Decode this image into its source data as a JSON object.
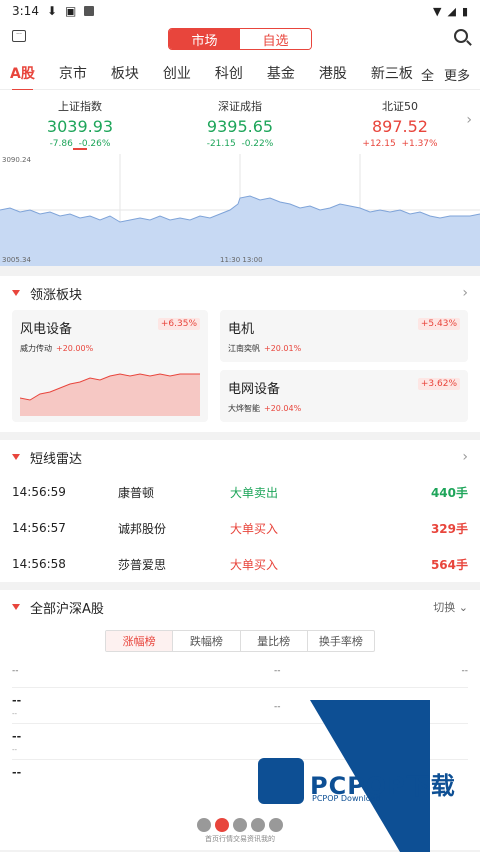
{
  "status": {
    "time": "3:14"
  },
  "header": {
    "seg_on": "市场",
    "seg_off": "自选"
  },
  "tabs": [
    "A股",
    "京市",
    "板块",
    "创业",
    "科创",
    "基金",
    "港股",
    "新三板"
  ],
  "tabs_all": "全",
  "tabs_more": "更多",
  "indices": [
    {
      "name": "上证指数",
      "value": "3039.93",
      "chg": "-7.86",
      "pct": "-0.26%",
      "color": "green"
    },
    {
      "name": "深证成指",
      "value": "9395.65",
      "chg": "-21.15",
      "pct": "-0.22%",
      "color": "green"
    },
    {
      "name": "北证50",
      "value": "897.52",
      "chg": "+12.15",
      "pct": "+1.37%",
      "color": "red"
    }
  ],
  "intraday": {
    "high": "3090.24",
    "low": "3005.34",
    "mid_time": "11:30 13:00"
  },
  "leading": {
    "title": "领涨板块",
    "big": {
      "name": "风电设备",
      "pct": "+6.35%",
      "stock": "威力传动",
      "stock_pct": "+20.00%"
    },
    "small": [
      {
        "name": "电机",
        "pct": "+5.43%",
        "stock": "江南奕帆",
        "stock_pct": "+20.01%"
      },
      {
        "name": "电网设备",
        "pct": "+3.62%",
        "stock": "大烨智能",
        "stock_pct": "+20.04%"
      }
    ]
  },
  "radar": {
    "title": "短线雷达",
    "rows": [
      {
        "time": "14:56:59",
        "name": "康普顿",
        "action": "大单卖出",
        "amount": "440手",
        "color": "green"
      },
      {
        "time": "14:56:57",
        "name": "诚邦股份",
        "action": "大单买入",
        "amount": "329手",
        "color": "red"
      },
      {
        "time": "14:56:58",
        "name": "莎普爱思",
        "action": "大单买入",
        "amount": "564手",
        "color": "red"
      }
    ]
  },
  "allstocks": {
    "title": "全部沪深A股",
    "switch": "切换",
    "tabs": [
      "涨幅榜",
      "跌幅榜",
      "量比榜",
      "换手率榜"
    ]
  },
  "bottom_nav": "首页行情交易资讯我的",
  "watermark": {
    "brand": "PCPOP下载",
    "sub": "PCPOP Download"
  }
}
